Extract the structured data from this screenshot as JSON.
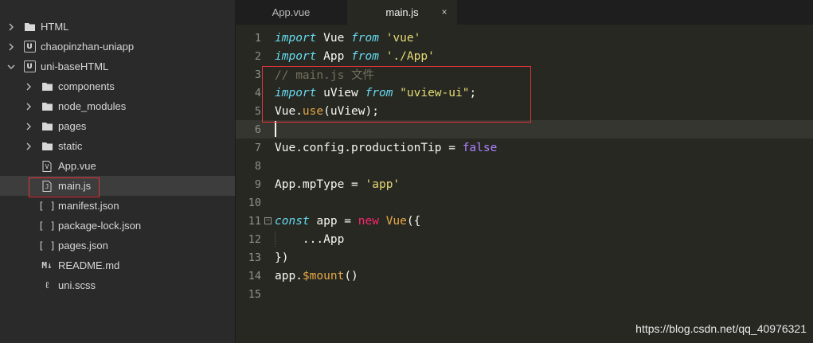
{
  "sidebar": {
    "items": [
      {
        "label": "HTML",
        "kind": "folder-root",
        "expanded": false,
        "icon": "folder-icon"
      },
      {
        "label": "chaopinzhan-uniapp",
        "kind": "project",
        "expanded": false,
        "icon": "uniapp-project-icon",
        "badge": "U"
      },
      {
        "label": "uni-baseHTML",
        "kind": "project",
        "expanded": true,
        "icon": "uniapp-project-icon",
        "badge": "U"
      },
      {
        "label": "components",
        "kind": "folder",
        "expanded": false,
        "icon": "folder-icon"
      },
      {
        "label": "node_modules",
        "kind": "folder",
        "expanded": false,
        "icon": "folder-icon"
      },
      {
        "label": "pages",
        "kind": "folder",
        "expanded": false,
        "icon": "folder-icon"
      },
      {
        "label": "static",
        "kind": "folder",
        "expanded": false,
        "icon": "folder-icon"
      },
      {
        "label": "App.vue",
        "kind": "file",
        "icon": "vue-file-icon",
        "glyph": "V"
      },
      {
        "label": "main.js",
        "kind": "file",
        "icon": "js-file-icon",
        "glyph": "J",
        "selected": true
      },
      {
        "label": "manifest.json",
        "kind": "file",
        "icon": "json-file-icon",
        "glyph": "[ ]"
      },
      {
        "label": "package-lock.json",
        "kind": "file",
        "icon": "json-file-icon",
        "glyph": "[ ]"
      },
      {
        "label": "pages.json",
        "kind": "file",
        "icon": "json-file-icon",
        "glyph": "[ ]"
      },
      {
        "label": "README.md",
        "kind": "file",
        "icon": "markdown-file-icon",
        "glyph": "M↓"
      },
      {
        "label": "uni.scss",
        "kind": "file",
        "icon": "scss-file-icon",
        "glyph": "ℓ"
      }
    ]
  },
  "tabs": [
    {
      "label": "App.vue",
      "active": false
    },
    {
      "label": "main.js",
      "active": true,
      "close": "×"
    }
  ],
  "editor": {
    "current_line": 6,
    "lines": [
      {
        "n": "1",
        "tokens": [
          {
            "t": "import",
            "c": "kw-i"
          },
          {
            "t": " Vue ",
            "c": ""
          },
          {
            "t": "from",
            "c": "kw-i"
          },
          {
            "t": " ",
            "c": ""
          },
          {
            "t": "'vue'",
            "c": "str"
          }
        ]
      },
      {
        "n": "2",
        "tokens": [
          {
            "t": "import",
            "c": "kw-i"
          },
          {
            "t": " App ",
            "c": ""
          },
          {
            "t": "from",
            "c": "kw-i"
          },
          {
            "t": " ",
            "c": ""
          },
          {
            "t": "'./App'",
            "c": "str"
          }
        ]
      },
      {
        "n": "3",
        "tokens": [
          {
            "t": "// main.js 文件",
            "c": "cmt"
          }
        ]
      },
      {
        "n": "4",
        "tokens": [
          {
            "t": "import",
            "c": "kw-i"
          },
          {
            "t": " uView ",
            "c": ""
          },
          {
            "t": "from",
            "c": "kw-i"
          },
          {
            "t": " ",
            "c": ""
          },
          {
            "t": "\"uview-ui\"",
            "c": "str"
          },
          {
            "t": ";",
            "c": ""
          }
        ]
      },
      {
        "n": "5",
        "tokens": [
          {
            "t": "Vue.",
            "c": ""
          },
          {
            "t": "use",
            "c": "fn"
          },
          {
            "t": "(uView);",
            "c": ""
          }
        ]
      },
      {
        "n": "6",
        "tokens": []
      },
      {
        "n": "7",
        "tokens": [
          {
            "t": "Vue.config.productionTip = ",
            "c": ""
          },
          {
            "t": "false",
            "c": "bool"
          }
        ]
      },
      {
        "n": "8",
        "tokens": []
      },
      {
        "n": "9",
        "tokens": [
          {
            "t": "App.mpType = ",
            "c": ""
          },
          {
            "t": "'app'",
            "c": "str"
          }
        ]
      },
      {
        "n": "10",
        "tokens": []
      },
      {
        "n": "11",
        "fold": "−",
        "tokens": [
          {
            "t": "const",
            "c": "kw-i"
          },
          {
            "t": " app = ",
            "c": ""
          },
          {
            "t": "new",
            "c": "new"
          },
          {
            "t": " ",
            "c": ""
          },
          {
            "t": "Vue",
            "c": "fn"
          },
          {
            "t": "({",
            "c": ""
          }
        ]
      },
      {
        "n": "12",
        "tokens": [
          {
            "t": "    ...App",
            "c": ""
          }
        ]
      },
      {
        "n": "13",
        "tokens": [
          {
            "t": "})",
            "c": ""
          }
        ]
      },
      {
        "n": "14",
        "tokens": [
          {
            "t": "app.",
            "c": ""
          },
          {
            "t": "$mount",
            "c": "fn"
          },
          {
            "t": "()",
            "c": ""
          }
        ]
      },
      {
        "n": "15",
        "tokens": []
      }
    ]
  },
  "watermark": "https://blog.csdn.net/qq_40976321",
  "colors": {
    "editor_bg": "#272822",
    "sidebar_bg": "#2a2a2a",
    "annotation_red": "#e0343a",
    "keyword": "#66d9ef",
    "string": "#e6db74",
    "comment": "#75715e",
    "function": "#e6a847",
    "boolean": "#ae81ff",
    "new_keyword": "#f92672"
  }
}
